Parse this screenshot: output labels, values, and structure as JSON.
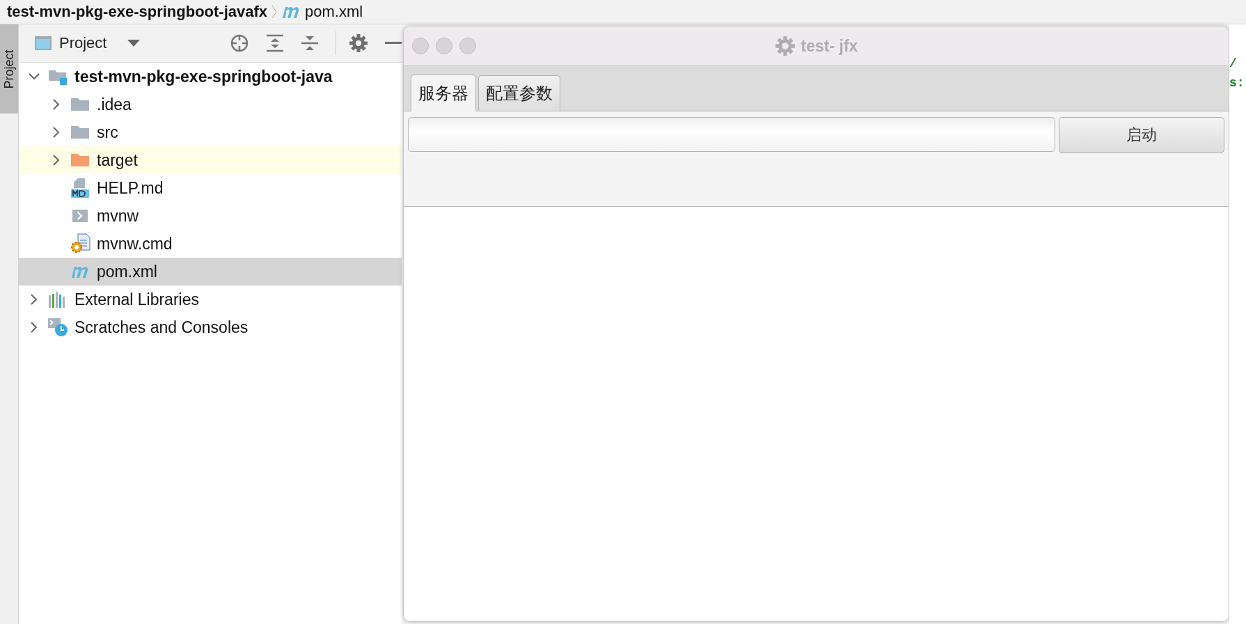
{
  "breadcrumb": [
    {
      "label": "test-mvn-pkg-exe-springboot-javafx",
      "kind": "project"
    },
    {
      "label": "pom.xml",
      "kind": "maven"
    }
  ],
  "side_strip": {
    "tab": "Project"
  },
  "project_panel": {
    "title": "Project",
    "tree": [
      {
        "label": "test-mvn-pkg-exe-springboot-java",
        "kind": "project",
        "expanded": true,
        "selected": false,
        "highlighted": false,
        "children": [
          {
            "label": ".idea",
            "kind": "folder",
            "expanded": false,
            "selected": false,
            "highlighted": false
          },
          {
            "label": "src",
            "kind": "folder",
            "expanded": false,
            "selected": false,
            "highlighted": false
          },
          {
            "label": "target",
            "kind": "excluded-folder",
            "expanded": false,
            "selected": false,
            "highlighted": true
          },
          {
            "label": "HELP.md",
            "kind": "markdown",
            "selected": false,
            "highlighted": false
          },
          {
            "label": "mvnw",
            "kind": "script",
            "selected": false,
            "highlighted": false
          },
          {
            "label": "mvnw.cmd",
            "kind": "cmd",
            "selected": false,
            "highlighted": false
          },
          {
            "label": "pom.xml",
            "kind": "maven",
            "selected": true,
            "highlighted": false
          }
        ]
      },
      {
        "label": "External Libraries",
        "kind": "libraries",
        "expanded": false,
        "selected": false,
        "highlighted": false
      },
      {
        "label": "Scratches and Consoles",
        "kind": "scratches",
        "expanded": false,
        "selected": false,
        "highlighted": false
      }
    ]
  },
  "app_window": {
    "title": "test- jfx",
    "tabs": [
      {
        "label": "服务器",
        "selected": true
      },
      {
        "label": "配置参数",
        "selected": false
      }
    ],
    "start_button": "启动"
  },
  "editor_fragments": [
    "/",
    "s:"
  ]
}
